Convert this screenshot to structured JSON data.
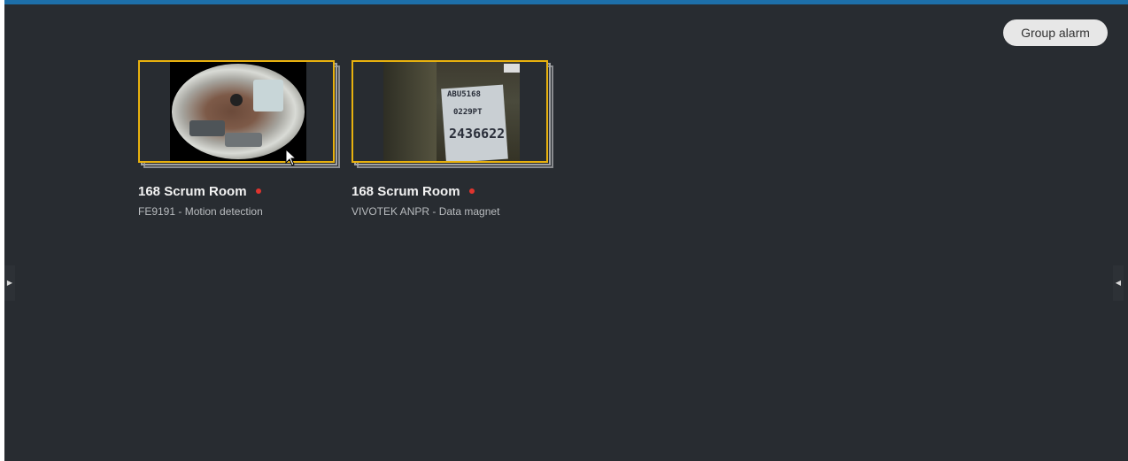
{
  "header": {
    "group_alarm_label": "Group alarm",
    "accent_color": "#1d6fa9"
  },
  "cards": [
    {
      "title": "168 Scrum Room",
      "subtitle": "FE9191 - Motion detection",
      "status_color": "#e0342e",
      "frame_color": "#e8b10e"
    },
    {
      "title": "168 Scrum Room",
      "subtitle": "VIVOTEK ANPR - Data magnet",
      "status_color": "#e0342e",
      "frame_color": "#e8b10e",
      "image_text": [
        "ABU5168",
        "0229PT",
        "2436622"
      ]
    }
  ],
  "nav": {
    "left_icon": "expand-left-panel-icon",
    "right_icon": "expand-right-panel-icon"
  }
}
